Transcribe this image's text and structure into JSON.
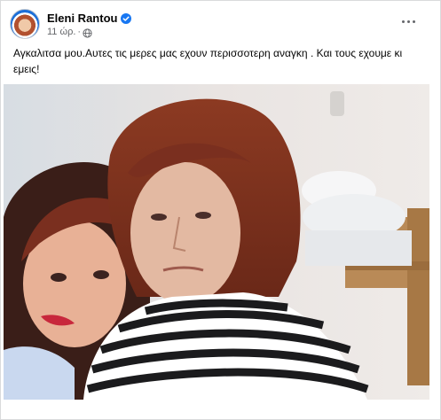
{
  "post": {
    "author": "Eleni Rantou",
    "verified_icon": "verified-badge-icon",
    "time": "11 ώρ.",
    "separator": "·",
    "audience_icon": "globe-icon",
    "more_icon": "more-options-icon",
    "caption": "Αγκαλιτσα μου.Αυτες τις μερες μας εχουν περισσοτερη αναγκη . Και τους εχουμε κι εμεις!",
    "photo_icon": "selfie-photo"
  },
  "colors": {
    "verified": "#1877f2",
    "text": "#050505",
    "secondary": "#65676b"
  }
}
